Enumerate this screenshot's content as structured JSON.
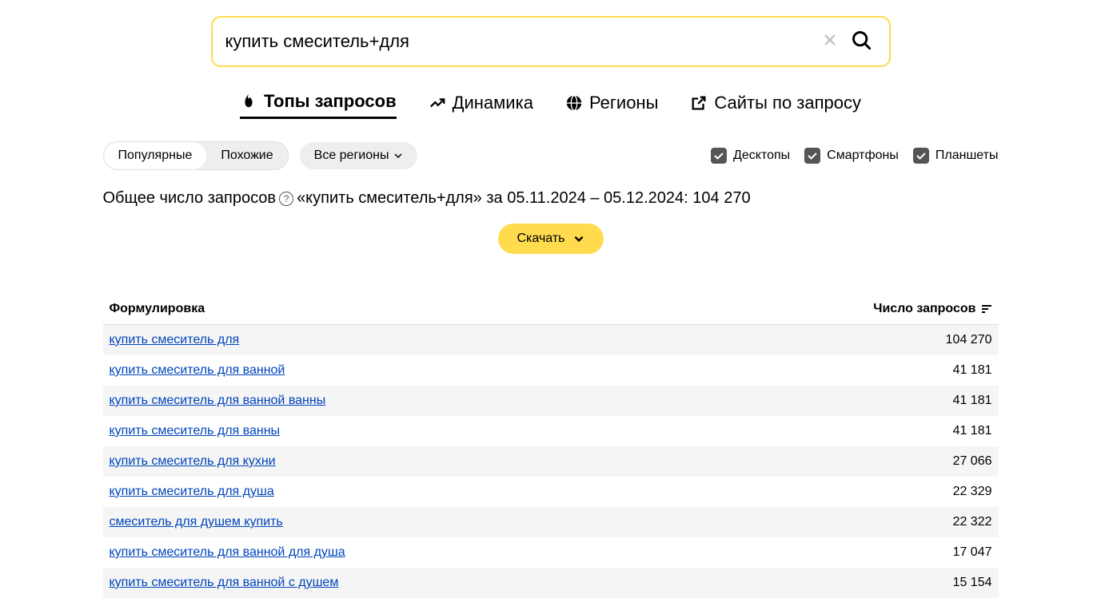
{
  "search": {
    "value": "купить смеситель+для"
  },
  "tabs": [
    {
      "label": "Топы запросов",
      "icon": "fire"
    },
    {
      "label": "Динамика",
      "icon": "trend"
    },
    {
      "label": "Регионы",
      "icon": "globe"
    },
    {
      "label": "Сайты по запросу",
      "icon": "external"
    }
  ],
  "filters": {
    "popular": "Популярные",
    "similar": "Похожие",
    "regions": "Все регионы"
  },
  "devices": {
    "desktop": "Десктопы",
    "smartphone": "Смартфоны",
    "tablet": "Планшеты"
  },
  "summary": {
    "prefix": "Общее число запросов",
    "middle": "«купить смеситель+для» за 05.11.2024 – 05.12.2024: 104 270"
  },
  "download": "Скачать",
  "columns": {
    "query": "Формулировка",
    "count": "Число запросов"
  },
  "rows": [
    {
      "query": "купить смеситель для",
      "count": "104 270"
    },
    {
      "query": "купить смеситель для ванной",
      "count": "41 181"
    },
    {
      "query": "купить смеситель для ванной ванны",
      "count": "41 181"
    },
    {
      "query": "купить смеситель для ванны",
      "count": "41 181"
    },
    {
      "query": "купить смеситель для кухни",
      "count": "27 066"
    },
    {
      "query": "купить смеситель для душа",
      "count": "22 329"
    },
    {
      "query": "смеситель для душем купить",
      "count": "22 322"
    },
    {
      "query": "купить смеситель для ванной для душа",
      "count": "17 047"
    },
    {
      "query": "купить смеситель для ванной с душем",
      "count": "15 154"
    }
  ]
}
